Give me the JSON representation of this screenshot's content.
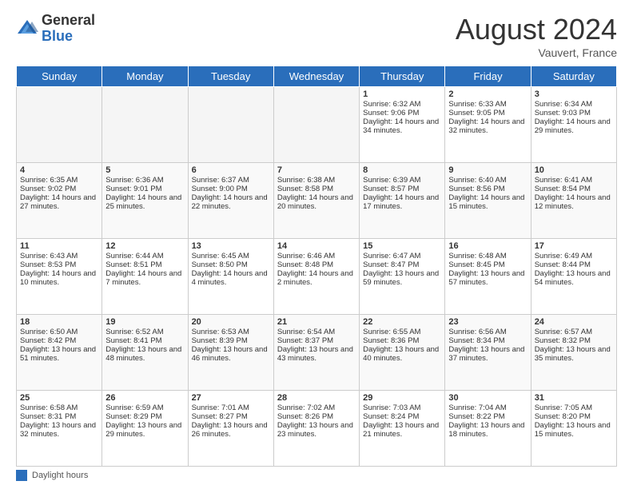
{
  "header": {
    "logo_general": "General",
    "logo_blue": "Blue",
    "month_year": "August 2024",
    "location": "Vauvert, France"
  },
  "days_of_week": [
    "Sunday",
    "Monday",
    "Tuesday",
    "Wednesday",
    "Thursday",
    "Friday",
    "Saturday"
  ],
  "footer": {
    "legend_label": "Daylight hours"
  },
  "weeks": [
    [
      {
        "day": "",
        "empty": true
      },
      {
        "day": "",
        "empty": true
      },
      {
        "day": "",
        "empty": true
      },
      {
        "day": "",
        "empty": true
      },
      {
        "day": "1",
        "sunrise": "Sunrise: 6:32 AM",
        "sunset": "Sunset: 9:06 PM",
        "daylight": "Daylight: 14 hours and 34 minutes."
      },
      {
        "day": "2",
        "sunrise": "Sunrise: 6:33 AM",
        "sunset": "Sunset: 9:05 PM",
        "daylight": "Daylight: 14 hours and 32 minutes."
      },
      {
        "day": "3",
        "sunrise": "Sunrise: 6:34 AM",
        "sunset": "Sunset: 9:03 PM",
        "daylight": "Daylight: 14 hours and 29 minutes."
      }
    ],
    [
      {
        "day": "4",
        "sunrise": "Sunrise: 6:35 AM",
        "sunset": "Sunset: 9:02 PM",
        "daylight": "Daylight: 14 hours and 27 minutes."
      },
      {
        "day": "5",
        "sunrise": "Sunrise: 6:36 AM",
        "sunset": "Sunset: 9:01 PM",
        "daylight": "Daylight: 14 hours and 25 minutes."
      },
      {
        "day": "6",
        "sunrise": "Sunrise: 6:37 AM",
        "sunset": "Sunset: 9:00 PM",
        "daylight": "Daylight: 14 hours and 22 minutes."
      },
      {
        "day": "7",
        "sunrise": "Sunrise: 6:38 AM",
        "sunset": "Sunset: 8:58 PM",
        "daylight": "Daylight: 14 hours and 20 minutes."
      },
      {
        "day": "8",
        "sunrise": "Sunrise: 6:39 AM",
        "sunset": "Sunset: 8:57 PM",
        "daylight": "Daylight: 14 hours and 17 minutes."
      },
      {
        "day": "9",
        "sunrise": "Sunrise: 6:40 AM",
        "sunset": "Sunset: 8:56 PM",
        "daylight": "Daylight: 14 hours and 15 minutes."
      },
      {
        "day": "10",
        "sunrise": "Sunrise: 6:41 AM",
        "sunset": "Sunset: 8:54 PM",
        "daylight": "Daylight: 14 hours and 12 minutes."
      }
    ],
    [
      {
        "day": "11",
        "sunrise": "Sunrise: 6:43 AM",
        "sunset": "Sunset: 8:53 PM",
        "daylight": "Daylight: 14 hours and 10 minutes."
      },
      {
        "day": "12",
        "sunrise": "Sunrise: 6:44 AM",
        "sunset": "Sunset: 8:51 PM",
        "daylight": "Daylight: 14 hours and 7 minutes."
      },
      {
        "day": "13",
        "sunrise": "Sunrise: 6:45 AM",
        "sunset": "Sunset: 8:50 PM",
        "daylight": "Daylight: 14 hours and 4 minutes."
      },
      {
        "day": "14",
        "sunrise": "Sunrise: 6:46 AM",
        "sunset": "Sunset: 8:48 PM",
        "daylight": "Daylight: 14 hours and 2 minutes."
      },
      {
        "day": "15",
        "sunrise": "Sunrise: 6:47 AM",
        "sunset": "Sunset: 8:47 PM",
        "daylight": "Daylight: 13 hours and 59 minutes."
      },
      {
        "day": "16",
        "sunrise": "Sunrise: 6:48 AM",
        "sunset": "Sunset: 8:45 PM",
        "daylight": "Daylight: 13 hours and 57 minutes."
      },
      {
        "day": "17",
        "sunrise": "Sunrise: 6:49 AM",
        "sunset": "Sunset: 8:44 PM",
        "daylight": "Daylight: 13 hours and 54 minutes."
      }
    ],
    [
      {
        "day": "18",
        "sunrise": "Sunrise: 6:50 AM",
        "sunset": "Sunset: 8:42 PM",
        "daylight": "Daylight: 13 hours and 51 minutes."
      },
      {
        "day": "19",
        "sunrise": "Sunrise: 6:52 AM",
        "sunset": "Sunset: 8:41 PM",
        "daylight": "Daylight: 13 hours and 48 minutes."
      },
      {
        "day": "20",
        "sunrise": "Sunrise: 6:53 AM",
        "sunset": "Sunset: 8:39 PM",
        "daylight": "Daylight: 13 hours and 46 minutes."
      },
      {
        "day": "21",
        "sunrise": "Sunrise: 6:54 AM",
        "sunset": "Sunset: 8:37 PM",
        "daylight": "Daylight: 13 hours and 43 minutes."
      },
      {
        "day": "22",
        "sunrise": "Sunrise: 6:55 AM",
        "sunset": "Sunset: 8:36 PM",
        "daylight": "Daylight: 13 hours and 40 minutes."
      },
      {
        "day": "23",
        "sunrise": "Sunrise: 6:56 AM",
        "sunset": "Sunset: 8:34 PM",
        "daylight": "Daylight: 13 hours and 37 minutes."
      },
      {
        "day": "24",
        "sunrise": "Sunrise: 6:57 AM",
        "sunset": "Sunset: 8:32 PM",
        "daylight": "Daylight: 13 hours and 35 minutes."
      }
    ],
    [
      {
        "day": "25",
        "sunrise": "Sunrise: 6:58 AM",
        "sunset": "Sunset: 8:31 PM",
        "daylight": "Daylight: 13 hours and 32 minutes."
      },
      {
        "day": "26",
        "sunrise": "Sunrise: 6:59 AM",
        "sunset": "Sunset: 8:29 PM",
        "daylight": "Daylight: 13 hours and 29 minutes."
      },
      {
        "day": "27",
        "sunrise": "Sunrise: 7:01 AM",
        "sunset": "Sunset: 8:27 PM",
        "daylight": "Daylight: 13 hours and 26 minutes."
      },
      {
        "day": "28",
        "sunrise": "Sunrise: 7:02 AM",
        "sunset": "Sunset: 8:26 PM",
        "daylight": "Daylight: 13 hours and 23 minutes."
      },
      {
        "day": "29",
        "sunrise": "Sunrise: 7:03 AM",
        "sunset": "Sunset: 8:24 PM",
        "daylight": "Daylight: 13 hours and 21 minutes."
      },
      {
        "day": "30",
        "sunrise": "Sunrise: 7:04 AM",
        "sunset": "Sunset: 8:22 PM",
        "daylight": "Daylight: 13 hours and 18 minutes."
      },
      {
        "day": "31",
        "sunrise": "Sunrise: 7:05 AM",
        "sunset": "Sunset: 8:20 PM",
        "daylight": "Daylight: 13 hours and 15 minutes."
      }
    ]
  ]
}
